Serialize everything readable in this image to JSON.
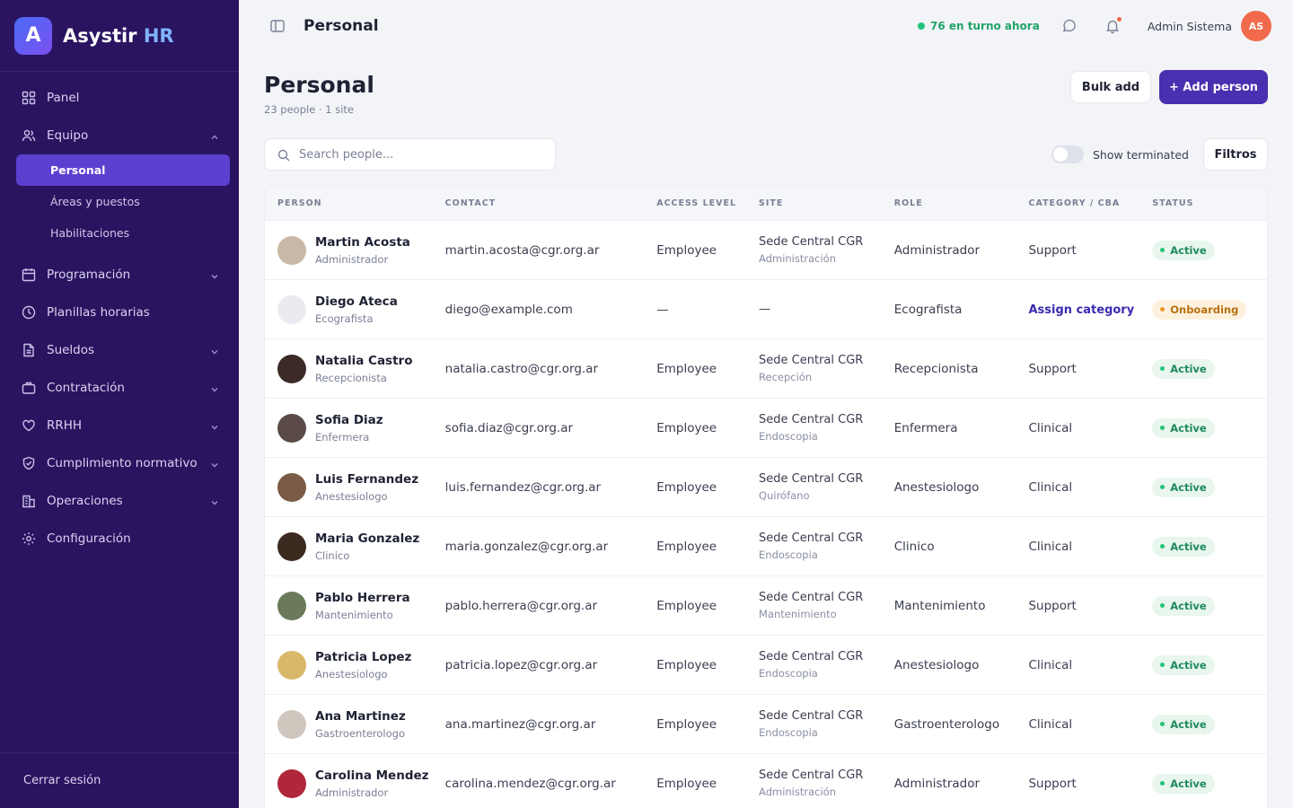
{
  "brand": {
    "letter": "A",
    "name": "Asystir",
    "accent": "HR"
  },
  "sidebar": {
    "items": [
      {
        "label": "Panel",
        "icon": "grid-icon"
      },
      {
        "label": "Equipo",
        "icon": "users-icon",
        "expanded": true
      },
      {
        "label": "Programación",
        "icon": "calendar-icon"
      },
      {
        "label": "Planillas horarias",
        "icon": "clock-icon"
      },
      {
        "label": "Sueldos",
        "icon": "document-icon"
      },
      {
        "label": "Contratación",
        "icon": "briefcase-icon"
      },
      {
        "label": "RRHH",
        "icon": "heart-icon"
      },
      {
        "label": "Cumplimiento normativo",
        "icon": "shield-icon"
      },
      {
        "label": "Operaciones",
        "icon": "building-icon"
      },
      {
        "label": "Configuración",
        "icon": "gear-icon"
      }
    ],
    "subitems": [
      {
        "label": "Personal",
        "active": true
      },
      {
        "label": "Áreas y puestos"
      },
      {
        "label": "Habilitaciones"
      }
    ],
    "logout": "Cerrar sesión"
  },
  "topbar": {
    "title": "Personal",
    "shift": "76 en turno ahora",
    "user": "Admin Sistema",
    "initials": "AS"
  },
  "header": {
    "title": "Personal",
    "subtitle": "23 people · 1 site",
    "bulk_label": "Bulk add",
    "add_label": "+ Add person"
  },
  "toolbar": {
    "search_placeholder": "Search people...",
    "toggle_label": "Show terminated",
    "filter_label": "Filtros"
  },
  "table": {
    "headers": [
      "PERSON",
      "CONTACT",
      "ACCESS LEVEL",
      "SITE",
      "ROLE",
      "CATEGORY / CBA",
      "STATUS"
    ],
    "rows": [
      {
        "name": "Martin Acosta",
        "title": "Administrador",
        "email": "martin.acosta@cgr.org.ar",
        "access": "Employee",
        "site": "Sede Central CGR",
        "site_sub": "Administración",
        "role": "Administrador",
        "category": "Support",
        "status": "Active",
        "avatar_color": "#c9b8a6"
      },
      {
        "name": "Diego Ateca",
        "title": "Ecografista",
        "email": "diego@example.com",
        "access": "—",
        "site": "—",
        "site_sub": "",
        "role": "Ecografista",
        "category": "Assign category",
        "status": "Onboarding",
        "avatar_color": "#e9ebf0"
      },
      {
        "name": "Natalia Castro",
        "title": "Recepcionista",
        "email": "natalia.castro@cgr.org.ar",
        "access": "Employee",
        "site": "Sede Central CGR",
        "site_sub": "Recepción",
        "role": "Recepcionista",
        "category": "Support",
        "status": "Active",
        "avatar_color": "#3b2a27"
      },
      {
        "name": "Sofia Diaz",
        "title": "Enfermera",
        "email": "sofia.diaz@cgr.org.ar",
        "access": "Employee",
        "site": "Sede Central CGR",
        "site_sub": "Endoscopia",
        "role": "Enfermera",
        "category": "Clinical",
        "status": "Active",
        "avatar_color": "#5a4a48"
      },
      {
        "name": "Luis Fernandez",
        "title": "Anestesiologo",
        "email": "luis.fernandez@cgr.org.ar",
        "access": "Employee",
        "site": "Sede Central CGR",
        "site_sub": "Quirófano",
        "role": "Anestesiologo",
        "category": "Clinical",
        "status": "Active",
        "avatar_color": "#7a5b45"
      },
      {
        "name": "Maria Gonzalez",
        "title": "Clinico",
        "email": "maria.gonzalez@cgr.org.ar",
        "access": "Employee",
        "site": "Sede Central CGR",
        "site_sub": "Endoscopia",
        "role": "Clinico",
        "category": "Clinical",
        "status": "Active",
        "avatar_color": "#3a2a20"
      },
      {
        "name": "Pablo Herrera",
        "title": "Mantenimiento",
        "email": "pablo.herrera@cgr.org.ar",
        "access": "Employee",
        "site": "Sede Central CGR",
        "site_sub": "Mantenimiento",
        "role": "Mantenimiento",
        "category": "Support",
        "status": "Active",
        "avatar_color": "#6a7a5a"
      },
      {
        "name": "Patricia Lopez",
        "title": "Anestesiologo",
        "email": "patricia.lopez@cgr.org.ar",
        "access": "Employee",
        "site": "Sede Central CGR",
        "site_sub": "Endoscopia",
        "role": "Anestesiologo",
        "category": "Clinical",
        "status": "Active",
        "avatar_color": "#d9b86a"
      },
      {
        "name": "Ana Martinez",
        "title": "Gastroenterologo",
        "email": "ana.martinez@cgr.org.ar",
        "access": "Employee",
        "site": "Sede Central CGR",
        "site_sub": "Endoscopia",
        "role": "Gastroenterologo",
        "category": "Clinical",
        "status": "Active",
        "avatar_color": "#cfc6bd"
      },
      {
        "name": "Carolina Mendez",
        "title": "Administrador",
        "email": "carolina.mendez@cgr.org.ar",
        "access": "Employee",
        "site": "Sede Central CGR",
        "site_sub": "Administración",
        "role": "Administrador",
        "category": "Support",
        "status": "Active",
        "avatar_color": "#b0263a"
      }
    ]
  }
}
